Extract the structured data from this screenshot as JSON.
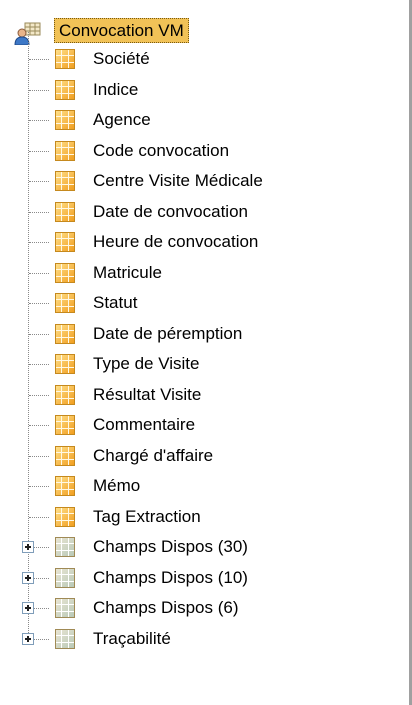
{
  "tree": {
    "root": {
      "label": "Convocation VM",
      "icon": "table-user-icon"
    },
    "fields": [
      "Société",
      "Indice",
      "Agence",
      "Code convocation",
      "Centre Visite Médicale",
      "Date de convocation",
      "Heure de convocation",
      "Matricule",
      "Statut",
      "Date de péremption",
      "Type de Visite",
      "Résultat Visite",
      "Commentaire",
      "Chargé d'affaire",
      "Mémo",
      "Tag Extraction"
    ],
    "groups": [
      "Champs Dispos (30)",
      "Champs Dispos (10)",
      "Champs Dispos (6)",
      "Traçabilité"
    ],
    "field_icon": "field-icon",
    "group_icon": "field-group-icon",
    "expand_icon": "expand-plus-icon"
  }
}
